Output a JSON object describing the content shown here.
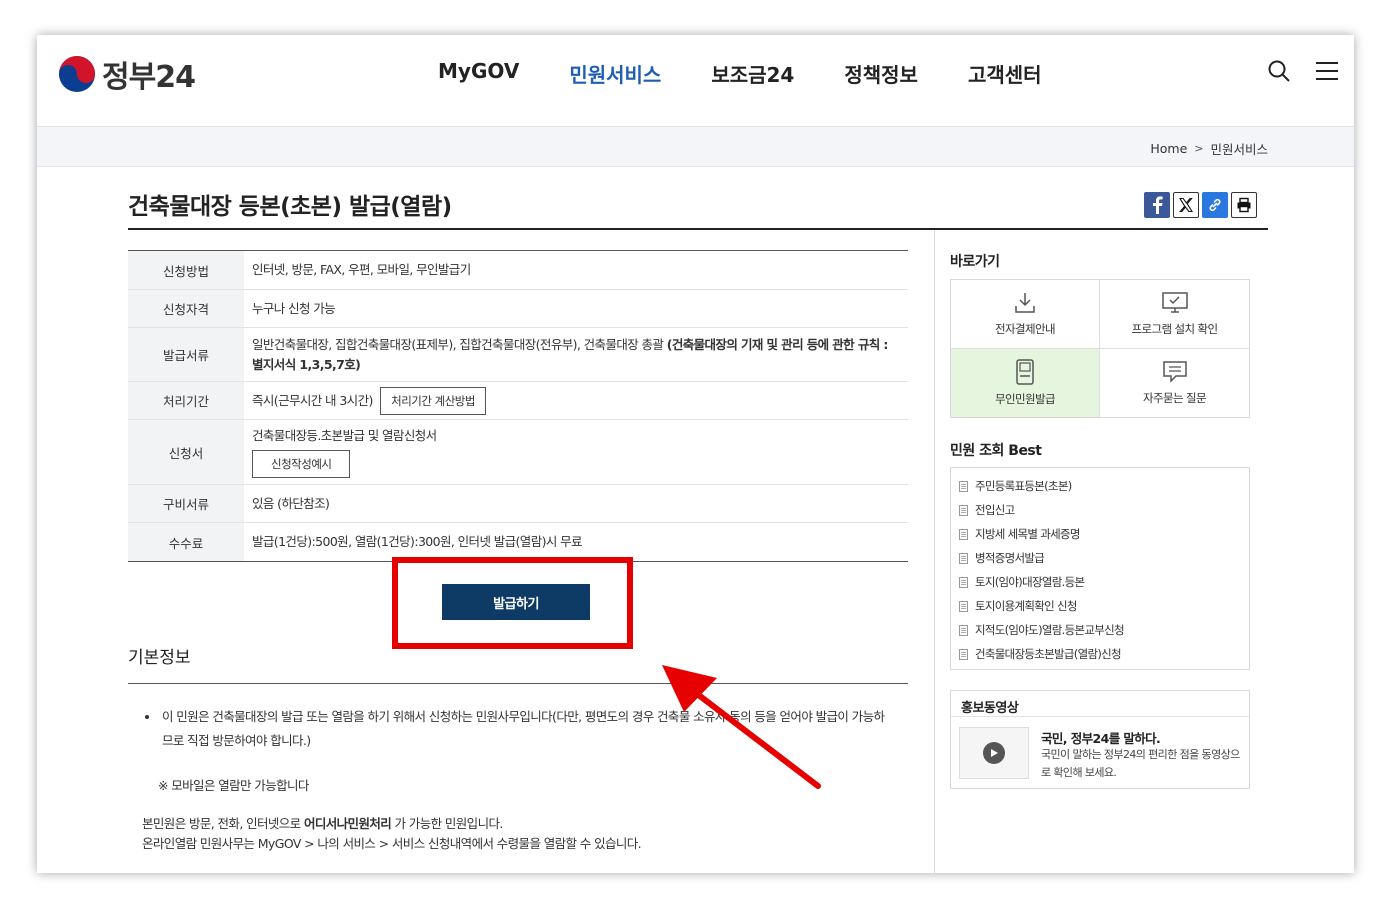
{
  "brand": {
    "logo_text": "정부24"
  },
  "gnb": [
    "MyGOV",
    "민원서비스",
    "보조금24",
    "정책정보",
    "고객센터"
  ],
  "breadcrumb": {
    "home": "Home",
    "current": "민원서비스"
  },
  "page": {
    "title": "건축물대장 등본(초본) 발급(열람)"
  },
  "info_table": {
    "method": {
      "label": "신청방법",
      "value": "인터넷, 방문, FAX, 우편, 모바일, 무인발급기"
    },
    "eligibility": {
      "label": "신청자격",
      "value": "누구나 신청 가능"
    },
    "docs": {
      "label": "발급서류",
      "value": "일반건축물대장, 집합건축물대장(표제부), 집합건축물대장(전유부), 건축물대장 총괄 ",
      "bold": "(건축물대장의 기재 및 관리 등에 관한 규칙 : 별지서식 1,3,5,7호)"
    },
    "period": {
      "label": "처리기간",
      "value": "즉시(근무시간 내 3시간)",
      "button": "처리기간 계산방법"
    },
    "form": {
      "label": "신청서",
      "value": "건축물대장등.초본발급 및 열람신청서",
      "button": "신청작성예시"
    },
    "required": {
      "label": "구비서류",
      "value": "있음 (하단참조)"
    },
    "fee": {
      "label": "수수료",
      "value": "발급(1건당):500원, 열람(1건당):300원, 인터넷 발급(열람)시 무료"
    }
  },
  "issue_button": "발급하기",
  "basic": {
    "title": "기본정보",
    "bullet": "이 민원은 건축물대장의 발급 또는 열람을 하기 위해서 신청하는 민원사무입니다(다만, 평면도의 경우 건축물 소유자 동의 등을 얻어야 발급이 가능하므로 직접 방문하여야 합니다.)",
    "note": "※ 모바일은 열람만 가능합니다",
    "p2_pre": "본민원은 방문, 전화, 인터넷으로 ",
    "p2_bold": "어디서나민원처리",
    "p2_post": " 가 가능한 민원입니다.",
    "p3": "온라인열람 민원사무는 MyGOV > 나의 서비스 > 서비스 신청내역에서 수령물을 열람할 수 있습니다."
  },
  "quick": {
    "title": "바로가기",
    "items": [
      "전자결제안내",
      "프로그램 설치 확인",
      "무인민원발급",
      "자주묻는 질문"
    ]
  },
  "best": {
    "title": "민원 조회 Best",
    "items": [
      "주민등록표등본(초본)",
      "전입신고",
      "지방세 세목별 과세증명",
      "병적증명서발급",
      "토지(임야)대장열람.등본",
      "토지이용계획확인 신청",
      "지적도(임야도)열람.등본교부신청",
      "건축물대장등초본발급(열람)신청"
    ]
  },
  "promo": {
    "title": "홍보동영상",
    "video_title": "국민, 정부24를 말하다.",
    "video_desc": "국민이 말하는 정부24의 편리한 점을 동영상으로 확인해 보세요."
  }
}
